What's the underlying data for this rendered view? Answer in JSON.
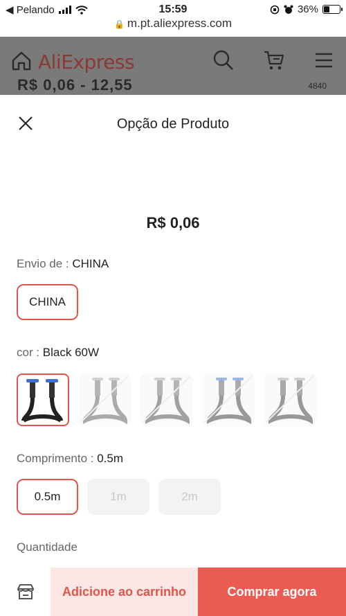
{
  "status_bar": {
    "carrier": "◀ Pelando",
    "time": "15:59",
    "battery": "36%",
    "battery_level": 0.36
  },
  "browser": {
    "url": "m.pt.aliexpress.com"
  },
  "page_header": {
    "logo": "AliExpress",
    "price_peek": "R$ 0,06 - 12,55",
    "count_peek": "4840"
  },
  "sheet": {
    "title": "Opção de Produto",
    "price": "R$ 0,06",
    "ship_from": {
      "label": "Envio de",
      "value": "CHINA",
      "options": [
        "CHINA"
      ],
      "selected": 0
    },
    "color": {
      "label": "cor",
      "value": "Black 60W",
      "options_count": 5,
      "selected": 0
    },
    "length": {
      "label": "Comprimento",
      "value": "0.5m",
      "options": [
        "0.5m",
        "1m",
        "2m"
      ],
      "selected": 0
    },
    "quantity": {
      "label": "Quantidade"
    }
  },
  "actions": {
    "add_to_cart": "Adicione ao carrinho",
    "buy_now": "Comprar agora"
  },
  "colors": {
    "accent": "#e0544b",
    "buy_bg": "#ea5b51",
    "add_bg": "#fde7e4"
  }
}
